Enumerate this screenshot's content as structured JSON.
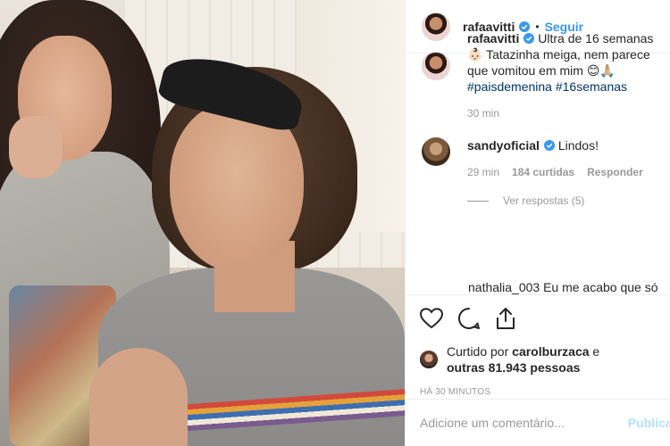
{
  "header": {
    "username": "rafaavitti",
    "separator": "•",
    "follow_label": "Seguir"
  },
  "caption": {
    "username": "rafaavitti",
    "text": "Ultra de 16 semanas 👶🏻 Tatazinha meiga, nem parece que vomitou em mim 😊🙏🏼",
    "hashtags": "#paisdemenina #16semanas",
    "time": "30 min"
  },
  "comment": {
    "username": "sandyoficial",
    "text": "Lindos!",
    "time": "29 min",
    "likes": "184 curtidas",
    "reply_label": "Responder",
    "view_replies": "Ver respostas (5)"
  },
  "partial_comment": "nathalia_003 Eu me acabo que só",
  "likes": {
    "prefix": "Curtido por",
    "user": "carolburzaca",
    "connector": "e",
    "others": "outras 81.943 pessoas"
  },
  "timestamp": "HÁ 30 MINUTOS",
  "add_comment": {
    "placeholder": "Adicione um comentário...",
    "publish_label": "Publicar"
  },
  "icons": {
    "verified": "verified-badge-icon",
    "like": "heart-icon",
    "comment": "comment-icon",
    "share": "share-icon"
  },
  "colors": {
    "link": "#3897f0",
    "verified": "#3897f0",
    "hashtag": "#003569",
    "muted": "#999999",
    "publish_disabled": "#b2dffc"
  }
}
